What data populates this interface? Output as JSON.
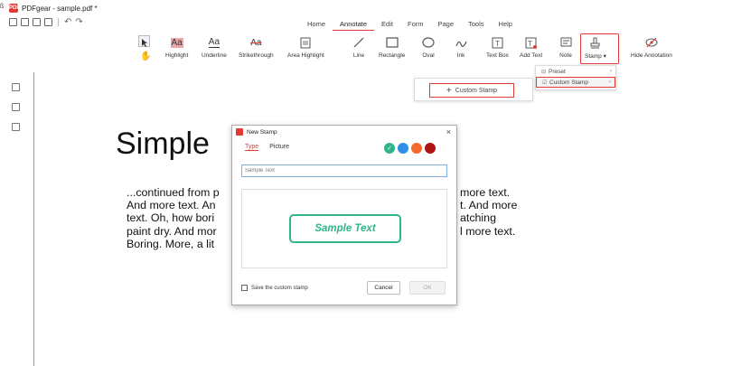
{
  "window": {
    "title": "PDFgear - sample.pdf *",
    "logo_text": "PDF",
    "left_glyph": "ß"
  },
  "menu": {
    "tabs": [
      "Home",
      "Annotate",
      "Edit",
      "Form",
      "Page",
      "Tools",
      "Help"
    ],
    "active_tab": "Annotate"
  },
  "ribbon": {
    "tools": [
      {
        "label": "Highlight",
        "icon": "highlight-icon"
      },
      {
        "label": "Underline",
        "icon": "underline-icon"
      },
      {
        "label": "Strikethrough",
        "icon": "strikethrough-icon"
      },
      {
        "label": "Area Highlight",
        "icon": "area-highlight-icon"
      },
      {
        "label": "Line",
        "icon": "line-icon"
      },
      {
        "label": "Rectangle",
        "icon": "rectangle-icon"
      },
      {
        "label": "Oval",
        "icon": "oval-icon"
      },
      {
        "label": "Ink",
        "icon": "ink-icon"
      },
      {
        "label": "Text Box",
        "icon": "text-box-icon"
      },
      {
        "label": "Add Text",
        "icon": "add-text-icon"
      },
      {
        "label": "Note",
        "icon": "note-icon"
      },
      {
        "label": "Stamp",
        "icon": "stamp-icon"
      },
      {
        "label": "Hide Annotation",
        "icon": "hide-annotation-icon"
      }
    ],
    "glyph_aa": "Aa"
  },
  "stamp_menu": {
    "items": [
      {
        "label": "Preset",
        "icon": "preset-icon"
      },
      {
        "label": "Custom Stamp",
        "icon": "custom-stamp-icon"
      }
    ]
  },
  "custom_stamp_button": {
    "label": "Custom Stamp",
    "plus": "+"
  },
  "document": {
    "heading": "Simple",
    "left_lines": [
      "...continued from p",
      "And more text. An",
      "text. Oh, how bori",
      "paint dry. And mor",
      "Boring.  More, a lit"
    ],
    "right_lines": [
      "more text.",
      "t. And more",
      "atching",
      "l more text."
    ]
  },
  "dialog": {
    "title": "New Stamp",
    "close": "×",
    "tabs": [
      "Type",
      "Picture"
    ],
    "active_tab": "Type",
    "input_placeholder": "Sample Text",
    "colors": [
      "#2fb58b",
      "#2f8fe6",
      "#f26a2e",
      "#b01515"
    ],
    "selected_color_check": "✓",
    "preview_text": "Sample Text",
    "save_label": "Save the custom stamp",
    "cancel_label": "Cancel",
    "ok_label": "OK"
  }
}
